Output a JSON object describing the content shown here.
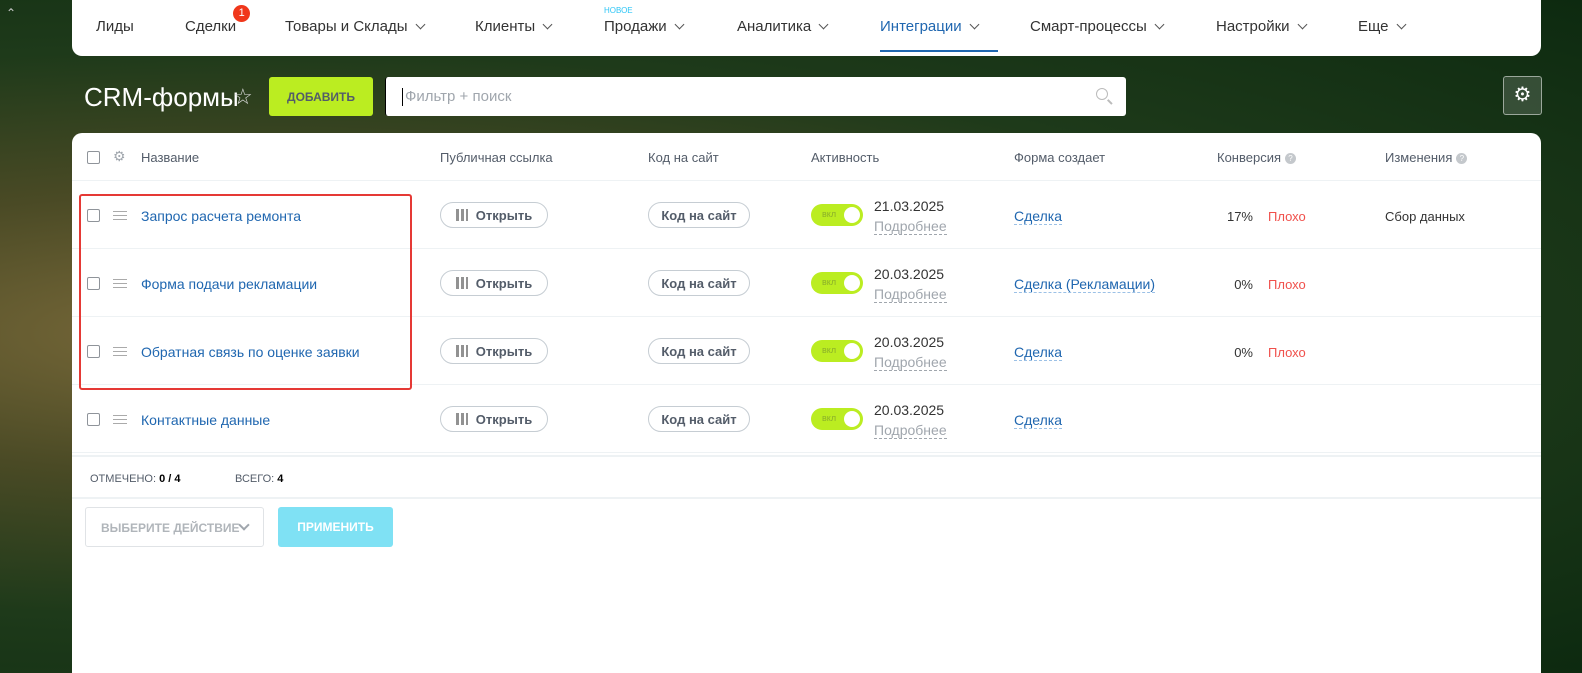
{
  "nav": {
    "items": [
      {
        "label": "Лиды"
      },
      {
        "label": "Сделки",
        "badge": "1"
      },
      {
        "label": "Товары и Склады"
      },
      {
        "label": "Клиенты"
      },
      {
        "label": "Продажи",
        "tag": "НОВОЕ"
      },
      {
        "label": "Аналитика"
      },
      {
        "label": "Интеграции"
      },
      {
        "label": "Смарт-процессы"
      },
      {
        "label": "Настройки"
      },
      {
        "label": "Еще"
      }
    ]
  },
  "page": {
    "title": "CRM-формы",
    "add_label": "ДОБАВИТЬ",
    "search_placeholder": "Фильтр + поиск"
  },
  "table": {
    "headers": {
      "name": "Название",
      "public": "Публичная ссылка",
      "code": "Код на сайт",
      "activity": "Активность",
      "creates": "Форма создает",
      "conversion": "Конверсия",
      "changes": "Изменения"
    },
    "rows": [
      {
        "name": "Запрос расчета ремонта",
        "open": "Открыть",
        "code": "Код на сайт",
        "toggle": "вкл",
        "date": "21.03.2025",
        "more": "Подробнее",
        "creates": "Сделка",
        "conv": "17%",
        "rating": "Плохо",
        "changes": "Сбор данных"
      },
      {
        "name": "Форма подачи рекламации",
        "open": "Открыть",
        "code": "Код на сайт",
        "toggle": "вкл",
        "date": "20.03.2025",
        "more": "Подробнее",
        "creates": "Сделка (Рекламации)",
        "conv": "0%",
        "rating": "Плохо",
        "changes": ""
      },
      {
        "name": "Обратная связь по оценке заявки",
        "open": "Открыть",
        "code": "Код на сайт",
        "toggle": "вкл",
        "date": "20.03.2025",
        "more": "Подробнее",
        "creates": "Сделка",
        "conv": "0%",
        "rating": "Плохо",
        "changes": ""
      },
      {
        "name": "Контактные данные",
        "open": "Открыть",
        "code": "Код на сайт",
        "toggle": "вкл",
        "date": "20.03.2025",
        "more": "Подробнее",
        "creates": "Сделка",
        "conv": "",
        "rating": "",
        "changes": ""
      }
    ]
  },
  "footer": {
    "selected_label": "ОТМЕЧЕНО:",
    "selected_value": "0 / 4",
    "total_label": "ВСЕГО:",
    "total_value": "4",
    "action_placeholder": "ВЫБЕРИТЕ ДЕЙСТВИЕ",
    "apply_label": "ПРИМЕНИТЬ"
  },
  "colors": {
    "accent": "#2067b0",
    "add": "#bbed21",
    "bad": "#f0504b",
    "apply": "#7fe1f4"
  }
}
